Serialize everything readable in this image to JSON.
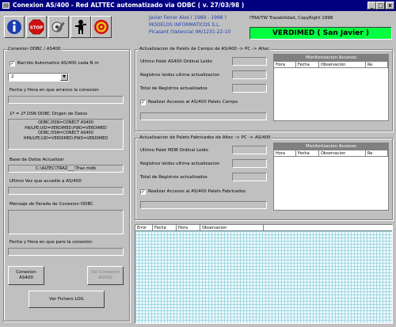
{
  "window": {
    "title": "Conexion AS/400 - Red ALTTEC automatizado via ODBC ( v. 27/03/98 )",
    "minimize": "_",
    "maximize": "□",
    "close": "x"
  },
  "toolbar": {
    "icons": [
      "info-icon",
      "stop-icon",
      "tools-icon",
      "person-icon",
      "target-icon"
    ]
  },
  "header": {
    "author_line": "Javier Ferrer Alos ( 1989 - 1998 )",
    "company_line": "MODELOS INFORMATICOS S.L.",
    "address_line": "Picasent (Valencia) 96/1231-22-10",
    "trademark_line": "ITRA/TW Trazabilidad, CopyRight 1998",
    "site": "VERDIMED ( San Javier )"
  },
  "odbc": {
    "group_title": "Conexion ODBC / AS400",
    "auto_label": "Barrido Automatico AS/400 cada N m",
    "auto_checked": "✓",
    "minutes_value": "2",
    "last_connect_label": "Fecha y Hora en que arranco la conexion",
    "data_sources_title": "1º = 2º DSN ODBC Origen de Datos",
    "data_sources": [
      "ODBC;DSN=CONECT AS400",
      "HA/LPE;UID=VERDIMED;PWD=VERDIMED",
      "ODBC;DSN=CONECT AS400",
      "HPA/LPE;UID=VERDIMED;PWD=VERDIMED"
    ],
    "db_label": "Base de Datos Actualizar",
    "db_value": "C:\\ALTEC\\TRAZ___\\Traz.mdb",
    "last_access_label": "Ultimo Vez que accedio a AS/400",
    "stop_msg_label": "Mensaje de Parada de Conexion ODBC",
    "stop_time_label": "Fecha y Hora en que paro la conexion"
  },
  "field_pallets": {
    "group_title": "Actualizacion de Palets de Campo de AS/400 -> PC -> Altec",
    "last_pallet_label": "Ultimo Palet AS400 Ordinal Leido",
    "records_label": "Registros leidos ultima actualizacion",
    "total_label": "Total de Registros actualizados",
    "realize_label": "Realizar Accesos al AS/400 Palets Campo",
    "realize_checked": "✓",
    "monitor_title": "Monitorizacion Accesos",
    "columns": [
      "Hora",
      "Fecha",
      "Observacion",
      "Re"
    ]
  },
  "factory_pallets": {
    "group_title": "Actualizacion de Palets Fabricados de Altec -> PC -> AS/400",
    "last_pallet_label": "Ultimo Palet MDB Ordinal Leido",
    "records_label": "Registros leidos ultima actualizacion",
    "total_label": "Total de Registros actualizados",
    "realize_label": "Realizar Accesos al AS/400 Palets Fabricados",
    "realize_checked": "✓",
    "monitor_title": "Monitorizacion Accesos",
    "columns": [
      "Hora",
      "Fecha",
      "Observacion",
      "Re"
    ]
  },
  "log": {
    "columns": [
      "Error",
      "Fecha",
      "Hora",
      "Observacion"
    ]
  },
  "buttons": {
    "connect": "Conexion AS400",
    "disconnect": "Sin Conexion AS400",
    "view_log": "Ver Fichero LOG"
  }
}
